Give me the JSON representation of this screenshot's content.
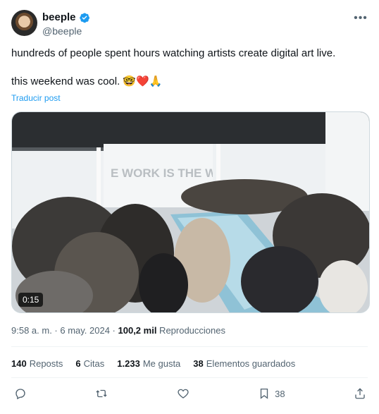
{
  "author": {
    "display_name": "beeple",
    "handle": "@beeple",
    "verified_color": "#1d9bf0"
  },
  "tweet": {
    "line1": "hundreds of people spent hours watching artists create digital art live.",
    "line2": "this weekend was cool. 🤓❤️🙏",
    "translate_label": "Traducir post"
  },
  "media": {
    "duration": "0:15",
    "screen_text": "E WORK IS THE W"
  },
  "meta": {
    "time_date": "9:58 a. m. · 6 may. 2024 · ",
    "views_count": "100,2 mil",
    "views_label": " Reproducciones"
  },
  "stats": [
    {
      "count": "140",
      "label": "Reposts"
    },
    {
      "count": "6",
      "label": "Citas"
    },
    {
      "count": "1.233",
      "label": "Me gusta"
    },
    {
      "count": "38",
      "label": "Elementos guardados"
    }
  ],
  "actions": {
    "bookmark_count": "38"
  }
}
